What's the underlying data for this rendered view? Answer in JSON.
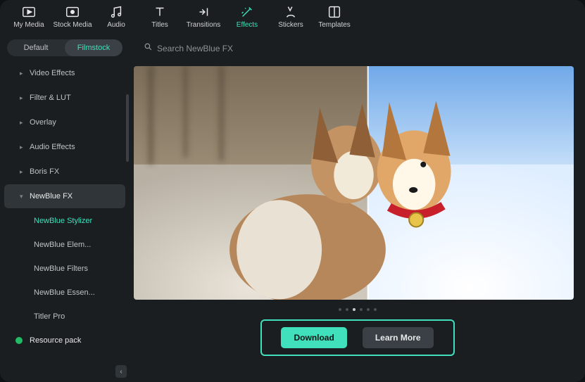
{
  "topnav": [
    {
      "id": "my-media",
      "label": "My Media"
    },
    {
      "id": "stock-media",
      "label": "Stock Media"
    },
    {
      "id": "audio",
      "label": "Audio"
    },
    {
      "id": "titles",
      "label": "Titles"
    },
    {
      "id": "transitions",
      "label": "Transitions"
    },
    {
      "id": "effects",
      "label": "Effects",
      "active": true
    },
    {
      "id": "stickers",
      "label": "Stickers"
    },
    {
      "id": "templates",
      "label": "Templates"
    }
  ],
  "pills": {
    "default": "Default",
    "filmstock": "Filmstock",
    "active": "filmstock"
  },
  "search": {
    "placeholder": "Search NewBlue FX"
  },
  "categories": [
    {
      "label": "Video Effects"
    },
    {
      "label": "Filter & LUT"
    },
    {
      "label": "Overlay"
    },
    {
      "label": "Audio Effects"
    },
    {
      "label": "Boris FX"
    },
    {
      "label": "NewBlue FX",
      "active": true,
      "sub": [
        {
          "label": "NewBlue Stylizer",
          "active": true
        },
        {
          "label": "NewBlue Elem..."
        },
        {
          "label": "NewBlue Filters"
        },
        {
          "label": "NewBlue Essen..."
        },
        {
          "label": "Titler Pro"
        }
      ]
    }
  ],
  "resource_pack": "Resource pack",
  "carousel": {
    "count": 6,
    "active": 2
  },
  "cta": {
    "download": "Download",
    "learn_more": "Learn More"
  },
  "colors": {
    "accent": "#3fe0bb",
    "bg": "#1a1e21"
  }
}
